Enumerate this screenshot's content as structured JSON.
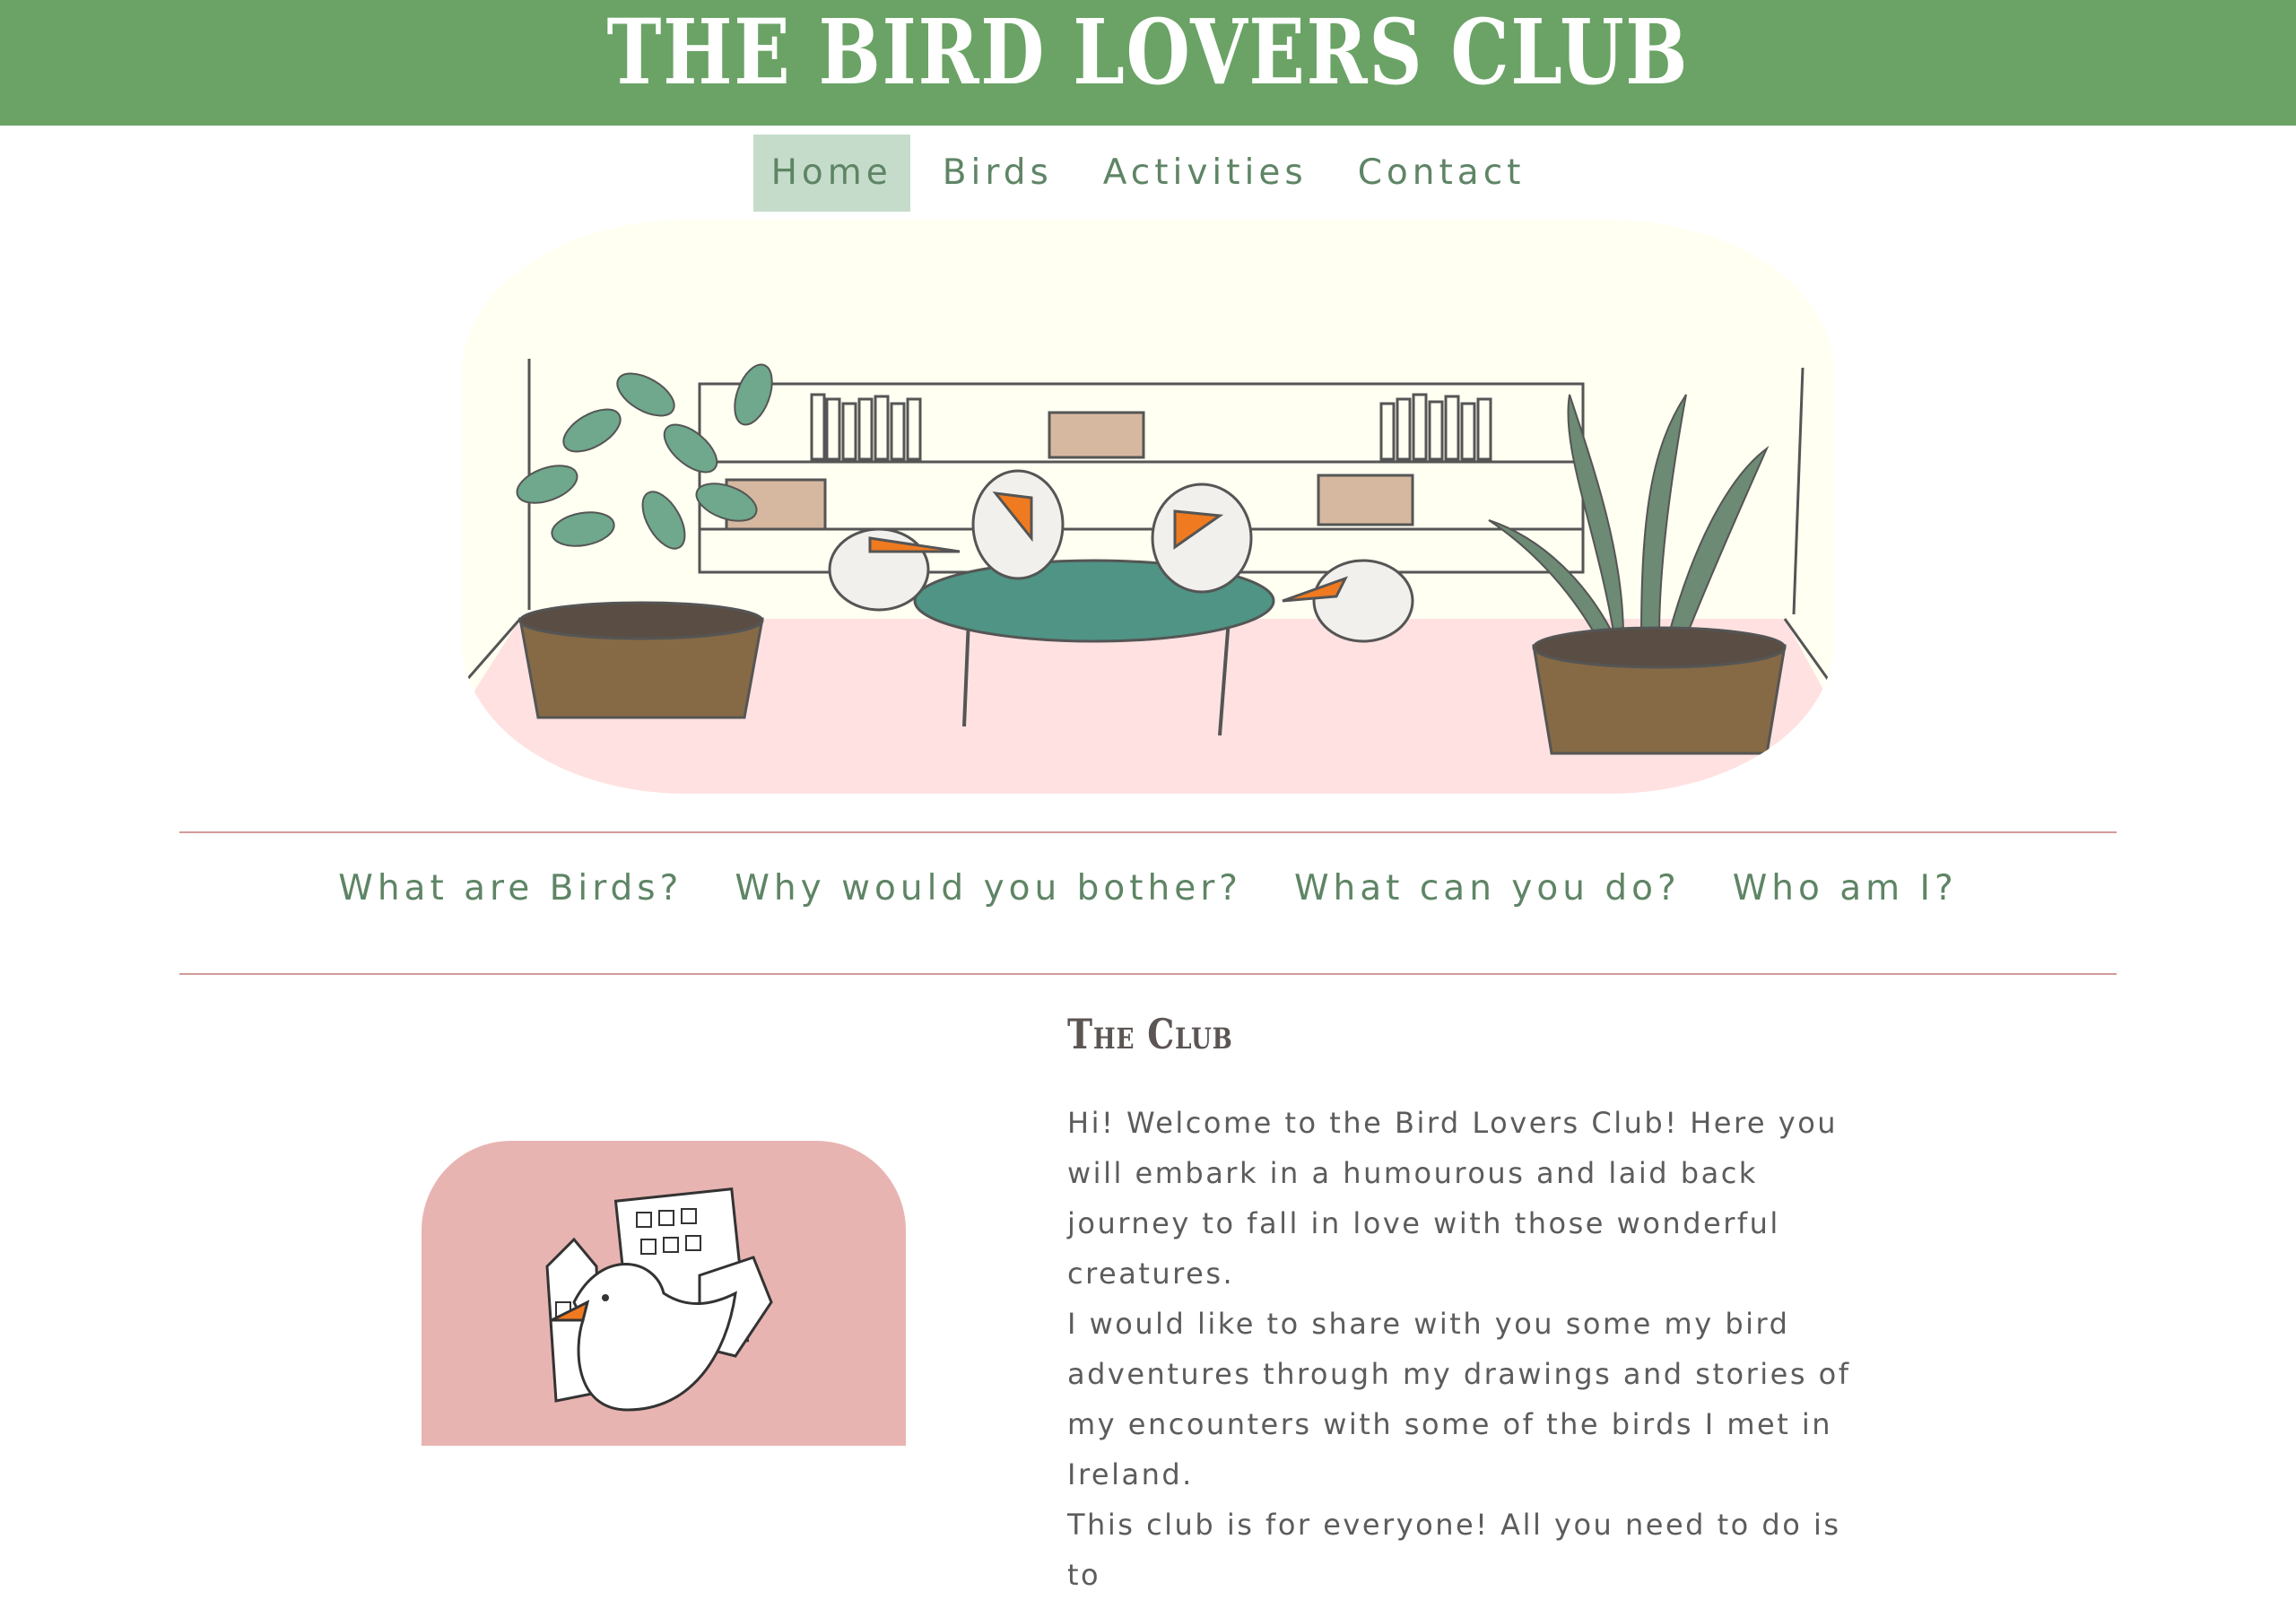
{
  "header": {
    "title": "THE BIRD LOVERS CLUB"
  },
  "nav": {
    "items": [
      {
        "label": "Home",
        "active": true
      },
      {
        "label": "Birds",
        "active": false
      },
      {
        "label": "Activities",
        "active": false
      },
      {
        "label": "Contact",
        "active": false
      }
    ]
  },
  "subnav": {
    "items": [
      {
        "label": "What are Birds?"
      },
      {
        "label": "Why would you bother?"
      },
      {
        "label": "What can you do?"
      },
      {
        "label": "Who am I?"
      }
    ]
  },
  "club": {
    "heading": "The Club",
    "paragraphs": [
      "Hi! Welcome to the Bird Lovers Club! Here you will embark in a humourous and laid back journey to fall in love with those wonderful creatures.",
      "I would like to share with you some my bird adventures through my drawings and stories of my encounters with some of the birds I met in Ireland.",
      "This club is for everyone! All you need to do is to"
    ]
  },
  "colors": {
    "header_bg": "#6aa365",
    "nav_text": "#5e8565",
    "nav_active_bg": "#c6dccb",
    "divider": "#d29a9a",
    "hero_wall": "#fffff2",
    "hero_floor": "#ffe1e1",
    "club_image_bg": "#e8b4b1",
    "beak": "#f07a1f",
    "table": "#4f9484"
  },
  "icons": {
    "hero": "birds-at-table-illustration",
    "club": "bird-with-houses-illustration"
  }
}
